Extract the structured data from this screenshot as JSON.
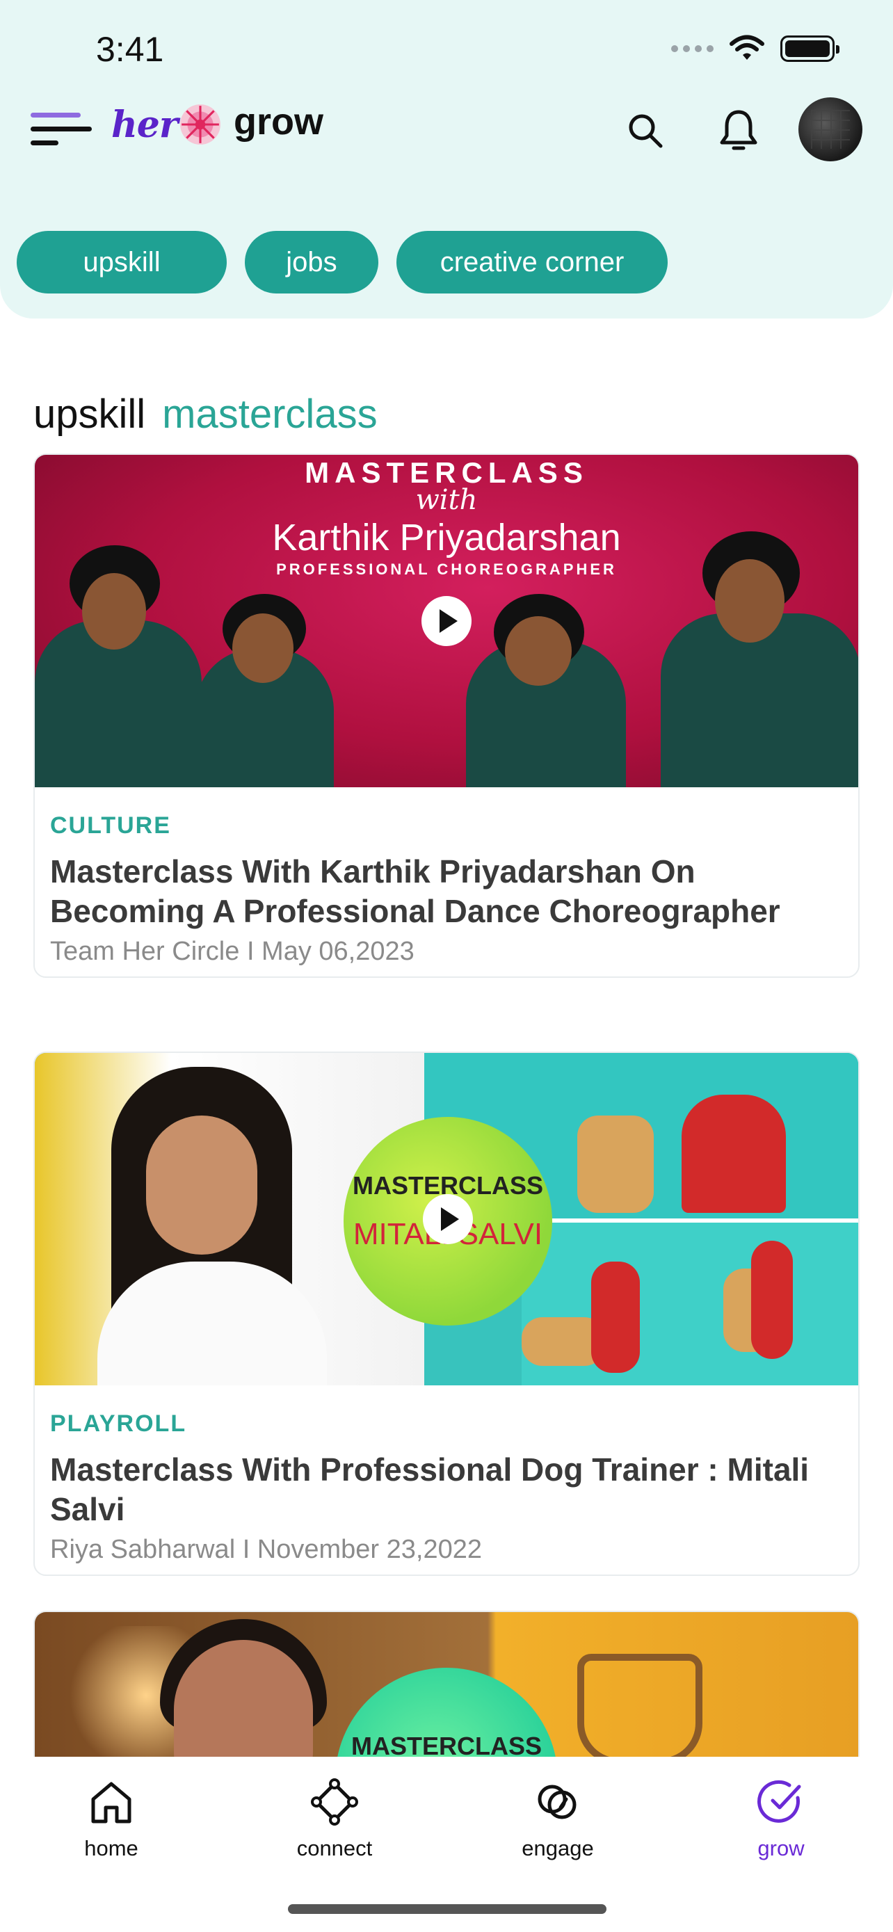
{
  "status_bar": {
    "time": "3:41"
  },
  "header": {
    "logo_text": "her",
    "section_title": "grow"
  },
  "chips": [
    {
      "label": "upskill"
    },
    {
      "label": "jobs"
    },
    {
      "label": "creative corner"
    }
  ],
  "heading": {
    "primary": "upskill",
    "secondary": "masterclass"
  },
  "cards": [
    {
      "thumbnail_text": [
        "MASTERCLASS",
        "with",
        "Karthik Priyadarshan",
        "PROFESSIONAL CHOREOGRAPHER"
      ],
      "category": "CULTURE",
      "title": "Masterclass With Karthik Priyadarshan On Becoming A Professional Dance Choreographer",
      "meta": "Team Her Circle I May 06,2023"
    },
    {
      "thumbnail_text": [
        "MASTERCLASS",
        "MITALI SALVI"
      ],
      "category": "PLAYROLL",
      "title": "Masterclass With Professional Dog Trainer : Mitali Salvi",
      "meta": "Riya Sabharwal I November 23,2022"
    },
    {
      "thumbnail_text": [
        "MASTERCLASS"
      ]
    }
  ],
  "bottom_nav": [
    {
      "label": "home",
      "icon": "home-icon"
    },
    {
      "label": "connect",
      "icon": "connect-icon"
    },
    {
      "label": "engage",
      "icon": "engage-icon"
    },
    {
      "label": "grow",
      "icon": "grow-check-icon",
      "active": true
    }
  ],
  "colors": {
    "accent_teal": "#1fa193",
    "brand_purple": "#5a24c9",
    "active_nav": "#6a2ad6",
    "header_bg": "#e6f7f5"
  }
}
